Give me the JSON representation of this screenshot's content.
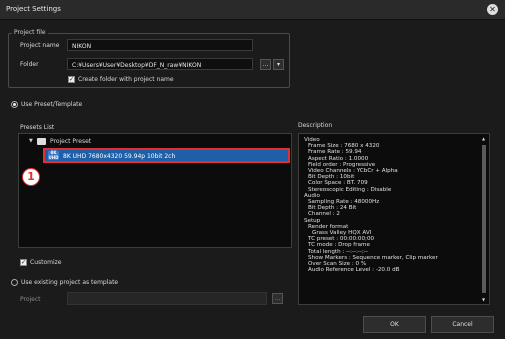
{
  "window": {
    "title": "Project Settings"
  },
  "project_file": {
    "group_label": "Project file",
    "name_label": "Project name",
    "name_value": "NIKON",
    "folder_label": "Folder",
    "folder_value": "C:¥Users¥User¥Desktop¥DF_N_raw¥NIKON",
    "browse_label": "...",
    "create_folder_label": "Create folder with project name"
  },
  "preset": {
    "radio_label": "Use Preset/Template",
    "list_label": "Presets List",
    "tree_folder": "Project Preset",
    "selected_item": "8K UHD 7680x4320 59.94p 10bit 2ch",
    "annotation_number": "1",
    "customize_label": "Customize"
  },
  "existing": {
    "radio_label": "Use existing project as template",
    "project_label": "Project",
    "project_value": "",
    "browse_label": "..."
  },
  "description": {
    "label": "Description",
    "lines": [
      {
        "indent": 0,
        "text": "Video"
      },
      {
        "indent": 1,
        "text": "Frame Size : 7680 x 4320"
      },
      {
        "indent": 1,
        "text": "Frame Rate : 59.94"
      },
      {
        "indent": 1,
        "text": "Aspect Ratio : 1.0000"
      },
      {
        "indent": 1,
        "text": "Field order : Progressive"
      },
      {
        "indent": 1,
        "text": "Video Channels : YCbCr + Alpha"
      },
      {
        "indent": 1,
        "text": "Bit Depth : 10bit"
      },
      {
        "indent": 1,
        "text": "Color Space : BT. 709"
      },
      {
        "indent": 1,
        "text": "Stereoscopic Editing : Disable"
      },
      {
        "indent": 0,
        "text": "Audio"
      },
      {
        "indent": 1,
        "text": "Sampling Rate : 48000Hz"
      },
      {
        "indent": 1,
        "text": "Bit Depth : 24 Bit"
      },
      {
        "indent": 1,
        "text": "Channel : 2"
      },
      {
        "indent": 0,
        "text": "Setup"
      },
      {
        "indent": 1,
        "text": "Render format"
      },
      {
        "indent": 2,
        "text": "Grass Valley HQX AVI"
      },
      {
        "indent": 1,
        "text": "TC preset : 00:00:00;00"
      },
      {
        "indent": 1,
        "text": "TC mode : Drop frame"
      },
      {
        "indent": 1,
        "text": "Total length : --:--:--;--"
      },
      {
        "indent": 1,
        "text": "Show Markers : Sequence marker, Clip marker"
      },
      {
        "indent": 1,
        "text": "Over Scan Size : 0 %"
      },
      {
        "indent": 1,
        "text": "Audio Reference Level : -20.0 dB"
      }
    ]
  },
  "buttons": {
    "ok": "OK",
    "cancel": "Cancel"
  },
  "colors": {
    "highlight": "#1e5fa8",
    "annotation": "#e03030"
  }
}
